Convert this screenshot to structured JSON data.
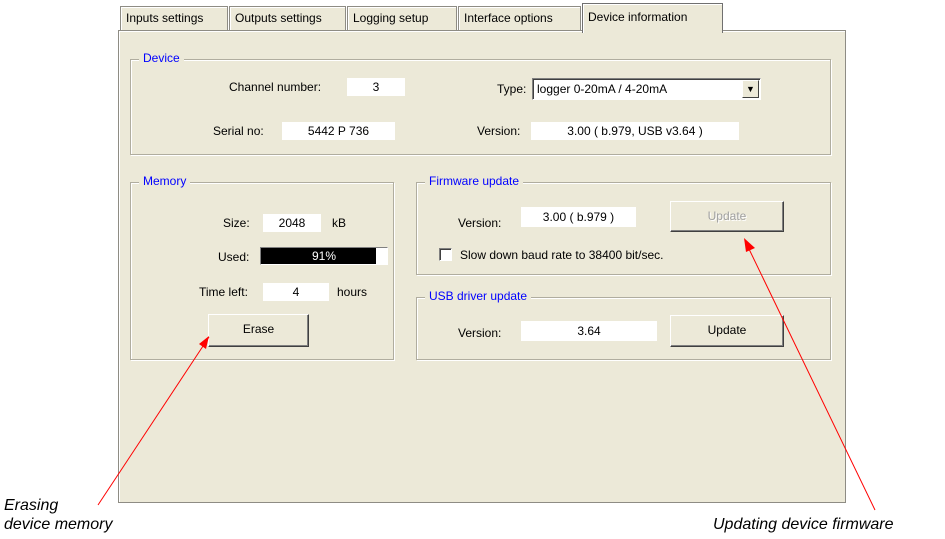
{
  "tabs": [
    {
      "label": "Inputs settings"
    },
    {
      "label": "Outputs settings"
    },
    {
      "label": "Logging setup"
    },
    {
      "label": "Interface options"
    },
    {
      "label": "Device information",
      "active": true
    }
  ],
  "device": {
    "legend": "Device",
    "channel_label": "Channel number:",
    "channel_value": "3",
    "type_label": "Type:",
    "type_value": "logger  0-20mA / 4-20mA",
    "serial_label": "Serial no:",
    "serial_value": "5442 P 736",
    "version_label": "Version:",
    "version_value": "3.00  ( b.979, USB v3.64 )"
  },
  "memory": {
    "legend": "Memory",
    "size_label": "Size:",
    "size_value": "2048",
    "size_unit": "kB",
    "used_label": "Used:",
    "used_text": "91%",
    "used_fraction": 0.91,
    "time_left_label": "Time left:",
    "time_left_value": "4",
    "time_left_unit": "hours",
    "erase_label": "Erase"
  },
  "firmware": {
    "legend": "Firmware update",
    "version_label": "Version:",
    "version_value": "3.00  ( b.979 )",
    "update_label": "Update",
    "update_enabled": false,
    "slow_label": "Slow down baud rate to 38400 bit/sec.",
    "slow_checked": false
  },
  "usb": {
    "legend": "USB driver update",
    "version_label": "Version:",
    "version_value": "3.64",
    "update_label": "Update"
  },
  "annotations": {
    "erase_caption_line1": "Erasing",
    "erase_caption_line2": "device memory",
    "firmware_caption": "Updating device firmware"
  },
  "colors": {
    "dialog_bg": "#ece9d8",
    "legend_text": "#0000ff",
    "annotation_arrow": "#ff0000"
  }
}
